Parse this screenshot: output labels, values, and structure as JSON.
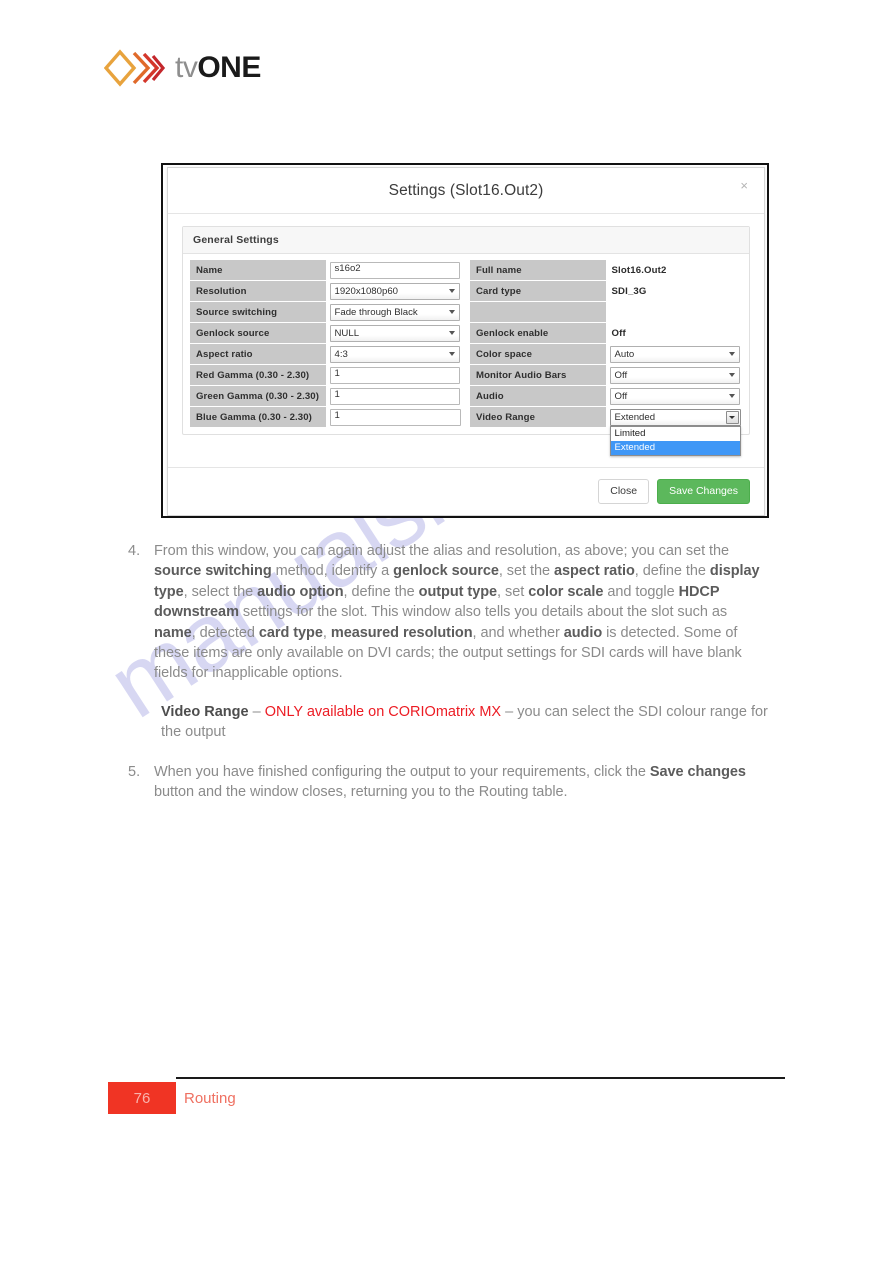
{
  "brand": {
    "logo_text_light": "tv",
    "logo_text_bold": "ONE",
    "logo_icon": "tvone-diamond-chevron-logo",
    "accent_orange": "#e8a33d",
    "accent_red": "#d4372b"
  },
  "watermark": {
    "text": "manualshive.com",
    "color": "#c9c9ee"
  },
  "dialog": {
    "title": "Settings (Slot16.Out2)",
    "close_label": "×",
    "panel_title": "General Settings",
    "left_fields": [
      {
        "label": "Name",
        "value": "s16o2",
        "control": "text"
      },
      {
        "label": "Resolution",
        "value": "1920x1080p60",
        "control": "select"
      },
      {
        "label": "Source switching",
        "value": "Fade through Black",
        "control": "select"
      },
      {
        "label": "Genlock source",
        "value": "NULL",
        "control": "select"
      },
      {
        "label": "Aspect ratio",
        "value": "4:3",
        "control": "select"
      },
      {
        "label": "Red Gamma (0.30 - 2.30)",
        "value": "1",
        "control": "text"
      },
      {
        "label": "Green Gamma (0.30 - 2.30)",
        "value": "1",
        "control": "text"
      },
      {
        "label": "Blue Gamma (0.30 - 2.30)",
        "value": "1",
        "control": "text"
      }
    ],
    "right_fields": [
      {
        "label": "Full name",
        "value": "Slot16.Out2",
        "control": "static"
      },
      {
        "label": "Card type",
        "value": "SDI_3G",
        "control": "static"
      },
      {
        "label": "",
        "value": "",
        "control": "empty"
      },
      {
        "label": "Genlock enable",
        "value": "Off",
        "control": "static"
      },
      {
        "label": "Color space",
        "value": "Auto",
        "control": "select"
      },
      {
        "label": "Monitor Audio Bars",
        "value": "Off",
        "control": "select"
      },
      {
        "label": "Audio",
        "value": "Off",
        "control": "select"
      },
      {
        "label": "Video Range",
        "value": "Extended",
        "control": "select-open"
      }
    ],
    "video_range_options": [
      "Limited",
      "Extended"
    ],
    "video_range_selected": "Extended",
    "buttons": {
      "close": "Close",
      "save": "Save Changes"
    }
  },
  "steps": [
    {
      "number": "4.",
      "html": "From this window, you can again adjust the alias and resolution, as above; you can set the <b>source switching</b> method, identify a <b>genlock source</b>, set the <b>aspect ratio</b>, define the <b>display type</b>, select the <b>audio option</b>, define the <b>output type</b>, set <b>color scale</b> and toggle <b>HDCP downstream</b> settings for the slot. This window also tells you details about the slot such as <b>name</b>, detected <b>card type</b>, <b>measured resolution</b>, and whether <b>audio</b> is detected. Some of these items are only available on DVI cards; the output settings for SDI cards will have blank fields for inapplicable options."
    },
    {
      "number": "5.",
      "html": "When you have finished configuring the output to your requirements, click the <b>Save changes</b> button and the window closes, returning you to the Routing table."
    }
  ],
  "note": {
    "html": "<b>Video Range</b> – <span class=\"red\">ONLY available on CORIOmatrix MX</span> – you can select the SDI colour range for the output"
  },
  "footer": {
    "page_number": "76",
    "section": "Routing"
  }
}
